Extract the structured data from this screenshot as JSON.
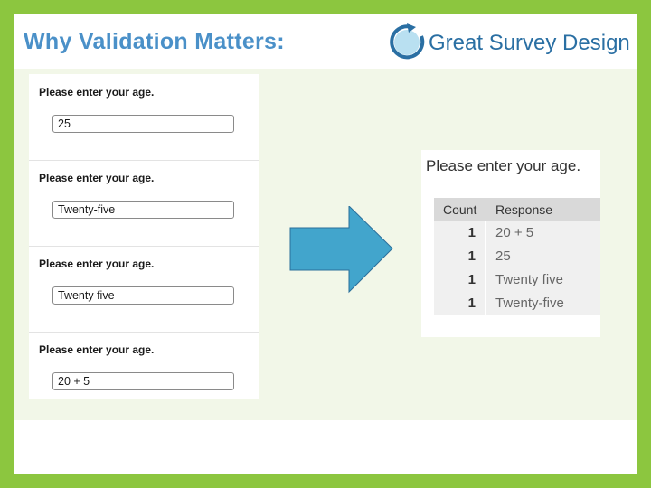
{
  "slide": {
    "title": "Why Validation Matters:",
    "logo_text": "Great Survey Design"
  },
  "form": {
    "questions": [
      {
        "label": "Please enter your age.",
        "value": "25"
      },
      {
        "label": "Please enter your age.",
        "value": "Twenty-five"
      },
      {
        "label": "Please enter your age.",
        "value": "Twenty five"
      },
      {
        "label": "Please enter your age.",
        "value": "20 + 5"
      }
    ]
  },
  "results": {
    "title": "Please enter your age.",
    "headers": {
      "count": "Count",
      "response": "Response"
    },
    "rows": [
      {
        "count": "1",
        "response": "20 + 5"
      },
      {
        "count": "1",
        "response": "25"
      },
      {
        "count": "1",
        "response": "Twenty five"
      },
      {
        "count": "1",
        "response": "Twenty-five"
      }
    ]
  },
  "colors": {
    "border": "#8cc63f",
    "title": "#4a90c8",
    "arrow": "#42a5cc",
    "content_bg": "#f2f7e8"
  }
}
